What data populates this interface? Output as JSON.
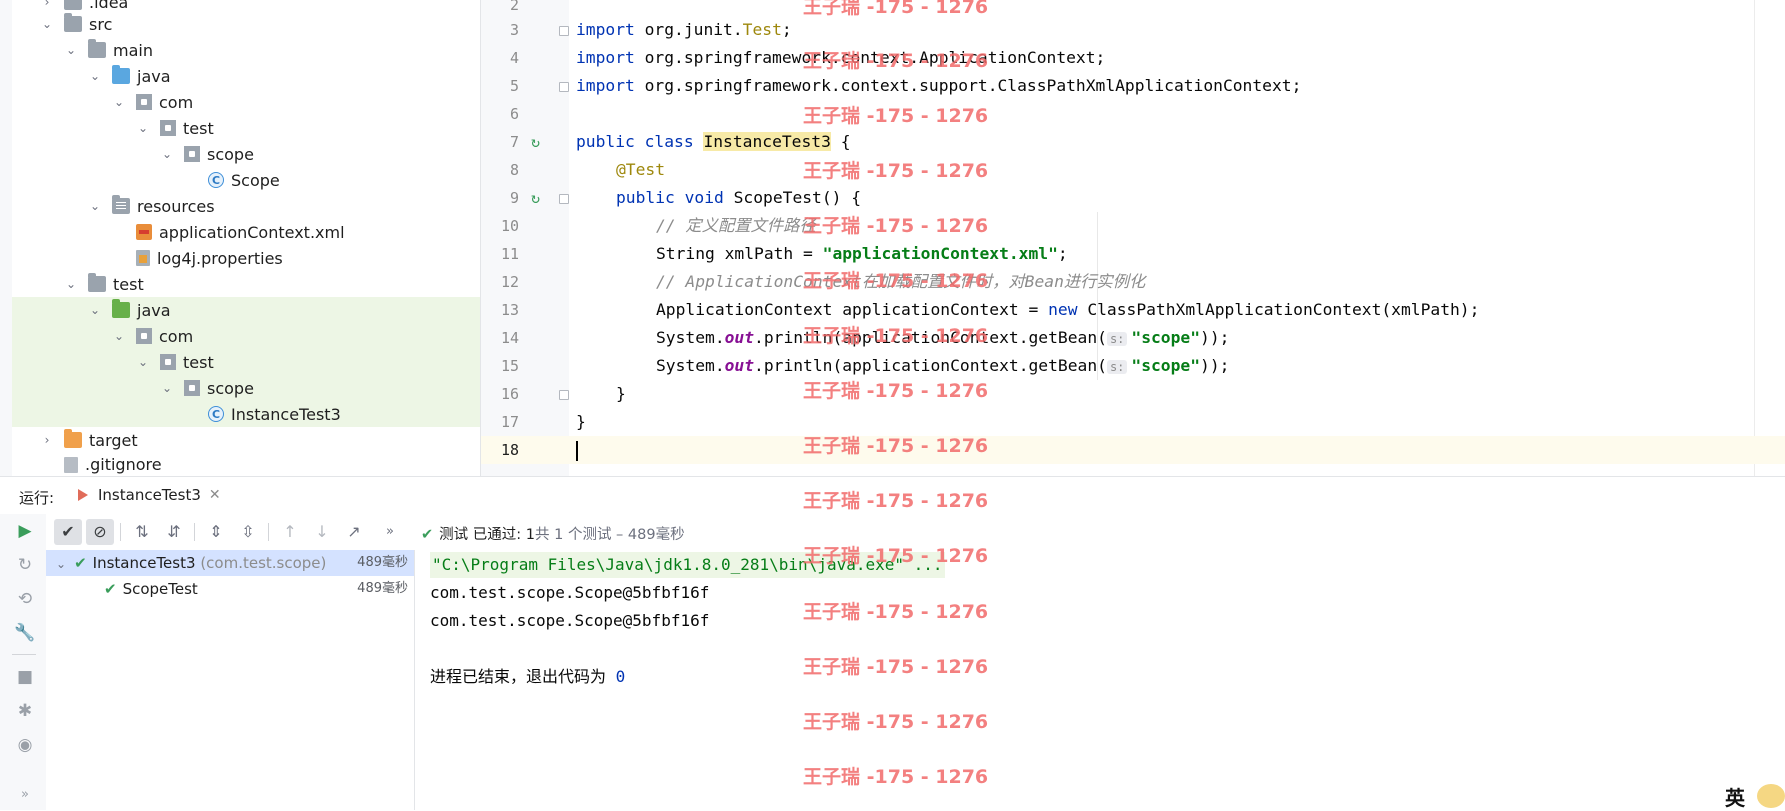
{
  "project_tree": {
    "items": [
      {
        "label": ".idea",
        "depth": 1,
        "expanded": false,
        "icon": "folder-icon"
      },
      {
        "label": "src",
        "depth": 1,
        "expanded": true,
        "icon": "folder-icon"
      },
      {
        "label": "main",
        "depth": 2,
        "expanded": true,
        "icon": "folder-icon"
      },
      {
        "label": "java",
        "depth": 3,
        "expanded": true,
        "icon": "source-folder-icon"
      },
      {
        "label": "com",
        "depth": 4,
        "expanded": true,
        "icon": "package-icon"
      },
      {
        "label": "test",
        "depth": 5,
        "expanded": true,
        "icon": "package-icon"
      },
      {
        "label": "scope",
        "depth": 6,
        "expanded": true,
        "icon": "package-icon"
      },
      {
        "label": "Scope",
        "depth": 7,
        "icon": "class-icon"
      },
      {
        "label": "resources",
        "depth": 3,
        "expanded": true,
        "icon": "resources-folder-icon"
      },
      {
        "label": "applicationContext.xml",
        "depth": 4,
        "icon": "xml-file-icon"
      },
      {
        "label": "log4j.properties",
        "depth": 4,
        "icon": "properties-file-icon"
      },
      {
        "label": "test",
        "depth": 2,
        "expanded": true,
        "icon": "folder-icon"
      },
      {
        "label": "java",
        "depth": 3,
        "expanded": true,
        "icon": "test-source-folder-icon"
      },
      {
        "label": "com",
        "depth": 4,
        "expanded": true,
        "icon": "package-icon"
      },
      {
        "label": "test",
        "depth": 5,
        "expanded": true,
        "icon": "package-icon"
      },
      {
        "label": "scope",
        "depth": 6,
        "expanded": true,
        "icon": "package-icon"
      },
      {
        "label": "InstanceTest3",
        "depth": 7,
        "icon": "test-class-icon"
      },
      {
        "label": "target",
        "depth": 1,
        "expanded": false,
        "icon": "excluded-folder-icon"
      },
      {
        "label": ".gitignore",
        "depth": 1,
        "icon": "gitignore-file-icon"
      }
    ]
  },
  "editor": {
    "line_numbers": [
      "2",
      "3",
      "4",
      "5",
      "6",
      "7",
      "8",
      "9",
      "10",
      "11",
      "12",
      "13",
      "14",
      "15",
      "16",
      "17",
      "18"
    ],
    "lines": {
      "l3_kw": "import",
      "l3_rest": " org.junit.",
      "l3_ann": "Test",
      "l3_end": ";",
      "l4_kw": "import",
      "l4_rest": " org.springframework.context.ApplicationContext;",
      "l5_kw": "import",
      "l5_rest": " org.springframework.context.support.ClassPathXmlApplicationContext;",
      "l7_kw": "public class",
      "l7_cls": "InstanceTest3",
      "l7_end": " {",
      "l8_ann": "@Test",
      "l9_kw": "public void",
      "l9_rest": " ScopeTest() {",
      "l10_cmt": "// 定义配置文件路径",
      "l11_a": "String xmlPath = ",
      "l11_str": "\"applicationContext.xml\"",
      "l11_end": ";",
      "l12_cmt": "// ApplicationContext在加载配置文件时，对Bean进行实例化",
      "l13_a": "ApplicationContext applicationContext = ",
      "l13_kw": "new",
      "l13_end": " ClassPathXmlApplicationContext(xmlPath);",
      "l14_a": "System.",
      "l14_out": "out",
      "l14_b": ".println(applicationContext.getBean(",
      "l14_hint": "s:",
      "l14_str": "\"scope\"",
      "l14_end": "));",
      "l15_a": "System.",
      "l15_out": "out",
      "l15_b": ".println(applicationContext.getBean(",
      "l15_hint": "s:",
      "l15_str": "\"scope\"",
      "l15_end": "));",
      "l16": "}",
      "l17": "}"
    }
  },
  "run_panel": {
    "label": "运行:",
    "tab_label": "InstanceTest3",
    "status": {
      "prefix": "测试 已通过:",
      "passed": "1",
      "count_text": "共 1 个测试 – 489毫秒"
    },
    "test_tree": [
      {
        "name": "InstanceTest3",
        "package": "(com.test.scope)",
        "duration": "489毫秒"
      },
      {
        "name": "ScopeTest",
        "duration": "489毫秒"
      }
    ],
    "console": [
      "\"C:\\Program Files\\Java\\jdk1.8.0_281\\bin\\java.exe\" ...",
      "com.test.scope.Scope@5bfbf16f",
      "com.test.scope.Scope@5bfbf16f",
      "",
      "进程已结束，退出代码为 ",
      "0"
    ]
  },
  "watermark": "王子瑞 -175 - 1276",
  "ime": {
    "label": "英"
  }
}
